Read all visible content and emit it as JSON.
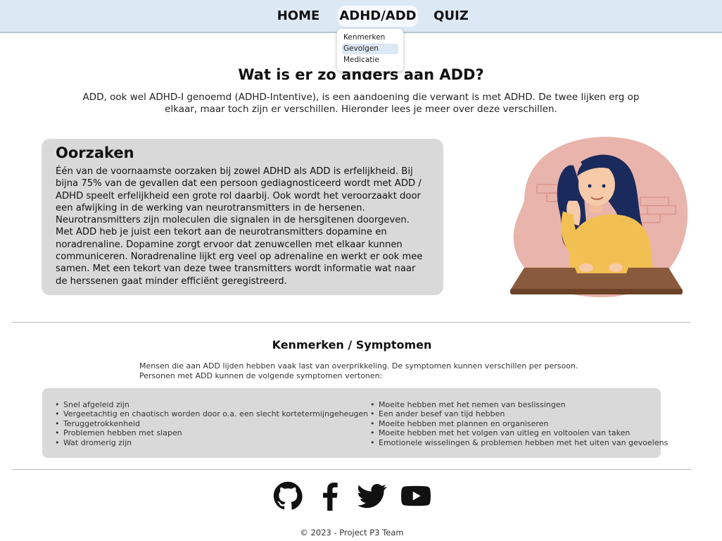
{
  "nav": {
    "items": [
      {
        "label": "HOME"
      },
      {
        "label": "ADHD/ADD"
      },
      {
        "label": "QUIZ"
      }
    ],
    "dropdown": [
      {
        "label": "Kenmerken"
      },
      {
        "label": "Gevolgen"
      },
      {
        "label": "Medicatie"
      }
    ]
  },
  "page": {
    "title": "Wat is er zo anders aan ADD?",
    "intro": "ADD, ook wel ADHD-I genoemd (ADHD-Intentive), is een aandoening die verwant is met ADHD. De twee lijken erg op elkaar, maar toch zijn er verschillen. Hieronder lees je meer over deze verschillen."
  },
  "causes": {
    "title": "Oorzaken",
    "text": "Één van de voornaamste oorzaken bij zowel ADHD als ADD is erfelijkheid. Bij bijna 75% van de gevallen dat een persoon gediagnosticeerd wordt met ADD / ADHD speelt erfelijkheid een grote rol daarbij. Ook wordt het veroorzaakt door een afwijking in de werking van neurotransmitters in de hersenen. Neurotransmitters zijn moleculen die signalen in de hersgitenen doorgeven. Met ADD heb je juist een tekort aan de neurotransmitters dopamine en noradrenaline. Dopamine zorgt ervoor dat zenuwcellen met elkaar kunnen communiceren. Noradrenaline lijkt erg veel op adrenaline en werkt er ook mee samen. Met een tekort van deze twee transmitters wordt informatie wat naar de herssenen gaat minder efficiënt geregistreerd."
  },
  "symptoms": {
    "title": "Kenmerken / Symptomen",
    "intro_line1": "Mensen die aan ADD lijden hebben vaak last van overprikkeling. De symptomen kunnen verschillen per persoon.",
    "intro_line2": "Personen met ADD kunnen de volgende symptomen vertonen:",
    "left": [
      "Snel afgeleid zijn",
      "Vergeetachtig en chaotisch worden door o.a. een slecht kortetermijngeheugen",
      "Teruggetrokkenheid",
      "Problemen hebben met slapen",
      "Wat dromerig zijn"
    ],
    "right": [
      "Moeite hebben met het nemen van beslissingen",
      "Een ander besef van tijd hebben",
      "Moeite hebben met plannen en organiseren",
      "Moeite hebben met het volgen van uitleg en voltooien van taken",
      "Emotionele wisselingen & problemen hebben met het uiten van gevoelens"
    ]
  },
  "footer": {
    "icons": [
      "github-icon",
      "facebook-icon",
      "twitter-icon",
      "youtube-icon"
    ],
    "copyright": "© 2023 - Project P3 Team"
  },
  "colors": {
    "nav_bg": "#dde8f5",
    "box_bg": "#d9d9d9",
    "blob": "#e8b4ab",
    "sweater": "#f2c052",
    "hair": "#1b2a5c",
    "table": "#8a5a3c"
  }
}
